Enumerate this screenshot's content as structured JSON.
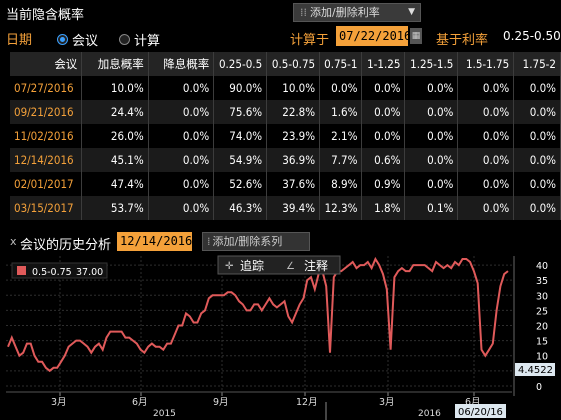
{
  "header": {
    "title": "当前隐含概率",
    "add_remove_label": "添加/删除利率"
  },
  "controls": {
    "date_label": "日期",
    "radio_meeting": "会议",
    "radio_calc": "计算",
    "calc_on_label": "计算于",
    "calc_date": "07/22/2016",
    "base_rate_label": "基于利率",
    "base_rate_value": "0.25-0.50"
  },
  "table": {
    "headers": [
      "会议",
      "加息概率",
      "降息概率",
      "0.25-0.5",
      "0.5-0.75",
      "0.75-1",
      "1-1.25",
      "1.25-1.5",
      "1.5-1.75",
      "1.75-2"
    ],
    "rows": [
      [
        "07/27/2016",
        "10.0%",
        "0.0%",
        "90.0%",
        "10.0%",
        "0.0%",
        "0.0%",
        "0.0%",
        "0.0%",
        "0.0%"
      ],
      [
        "09/21/2016",
        "24.4%",
        "0.0%",
        "75.6%",
        "22.8%",
        "1.6%",
        "0.0%",
        "0.0%",
        "0.0%",
        "0.0%"
      ],
      [
        "11/02/2016",
        "26.0%",
        "0.0%",
        "74.0%",
        "23.9%",
        "2.1%",
        "0.0%",
        "0.0%",
        "0.0%",
        "0.0%"
      ],
      [
        "12/14/2016",
        "45.1%",
        "0.0%",
        "54.9%",
        "36.9%",
        "7.7%",
        "0.6%",
        "0.0%",
        "0.0%",
        "0.0%"
      ],
      [
        "02/01/2017",
        "47.4%",
        "0.0%",
        "52.6%",
        "37.6%",
        "8.9%",
        "0.9%",
        "0.0%",
        "0.0%",
        "0.0%"
      ],
      [
        "03/15/2017",
        "53.7%",
        "0.0%",
        "46.3%",
        "39.4%",
        "12.3%",
        "1.8%",
        "0.1%",
        "0.0%",
        "0.0%"
      ]
    ]
  },
  "history": {
    "close_glyph": "x",
    "title": "会议的历史分析",
    "meeting_date": "12/14/2016",
    "add_series_label": "添加/删除系列",
    "track_label": "追踪",
    "annotate_label": "注释",
    "legend_label": "0.5-0.75",
    "legend_value": "37.00",
    "current_value": "4.4522",
    "cursor_date": "06/20/16"
  },
  "colors": {
    "amber": "#f4a13a",
    "series": "#e05a5a",
    "value_tag": "#dde8f0"
  },
  "chart_data": {
    "type": "line",
    "series": [
      {
        "name": "0.5-0.75",
        "values": [
          13,
          16,
          13,
          10,
          11,
          14,
          14,
          10,
          8,
          8,
          6,
          5,
          6,
          6,
          8,
          10,
          13,
          14,
          15,
          15,
          14,
          13,
          11,
          13,
          14,
          12,
          16,
          18,
          18,
          18,
          18,
          16,
          16,
          15,
          14,
          12,
          11,
          13,
          14,
          13,
          13,
          12,
          14,
          14,
          17,
          20,
          20,
          24,
          23,
          21,
          21,
          24,
          25,
          29,
          30,
          30,
          30,
          30,
          31,
          31,
          30,
          28,
          27,
          25,
          25,
          27,
          27,
          25,
          27,
          29,
          27,
          26,
          27,
          28,
          23,
          21,
          24,
          27,
          29,
          35,
          36,
          32,
          37,
          38,
          33,
          11,
          36,
          38,
          38,
          39,
          40,
          41,
          39,
          40,
          40,
          41,
          39,
          42,
          40,
          37,
          32,
          12,
          36,
          38,
          39,
          38,
          38,
          40,
          40,
          40,
          40,
          39,
          38,
          41,
          40,
          39,
          40,
          39,
          41,
          40,
          42,
          42,
          41,
          38,
          34,
          12,
          10,
          12,
          14,
          25,
          33,
          37,
          38
        ]
      }
    ],
    "x_ticks": [
      "3月",
      "6月",
      "9月",
      "12月",
      "3月",
      "6月"
    ],
    "year_ticks": [
      "2015",
      "2016"
    ],
    "y_ticks": [
      0,
      5,
      10,
      15,
      20,
      25,
      30,
      35,
      40
    ],
    "ylim": [
      -2,
      43
    ],
    "grid": true,
    "legend": "top-left"
  }
}
